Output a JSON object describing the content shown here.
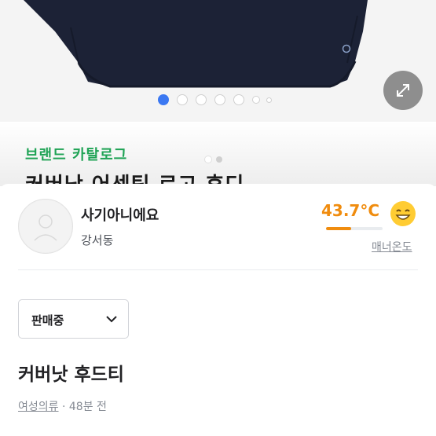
{
  "carousel": {
    "total_slides": 7,
    "active_index": 0,
    "expand_icon": "expand-arrows-icon"
  },
  "banner": {
    "brand_label": "브랜드 카탈로그",
    "title": "커버낫 어센틱 로고 후디",
    "brand_color": "#1fa355"
  },
  "seller": {
    "avatar_icon": "default-profile-icon",
    "nickname": "사기아니에요",
    "region": "강서동",
    "temperature": "43.7°C",
    "temperature_value": 43.7,
    "temperature_color": "#f08c0e",
    "mood_icon": "smiling-face-icon",
    "manner_label": "매너온도"
  },
  "product": {
    "status": "판매중",
    "title": "커버낫 후드티",
    "category": "여성의류",
    "separator": " · ",
    "time_ago": "48분 전"
  }
}
